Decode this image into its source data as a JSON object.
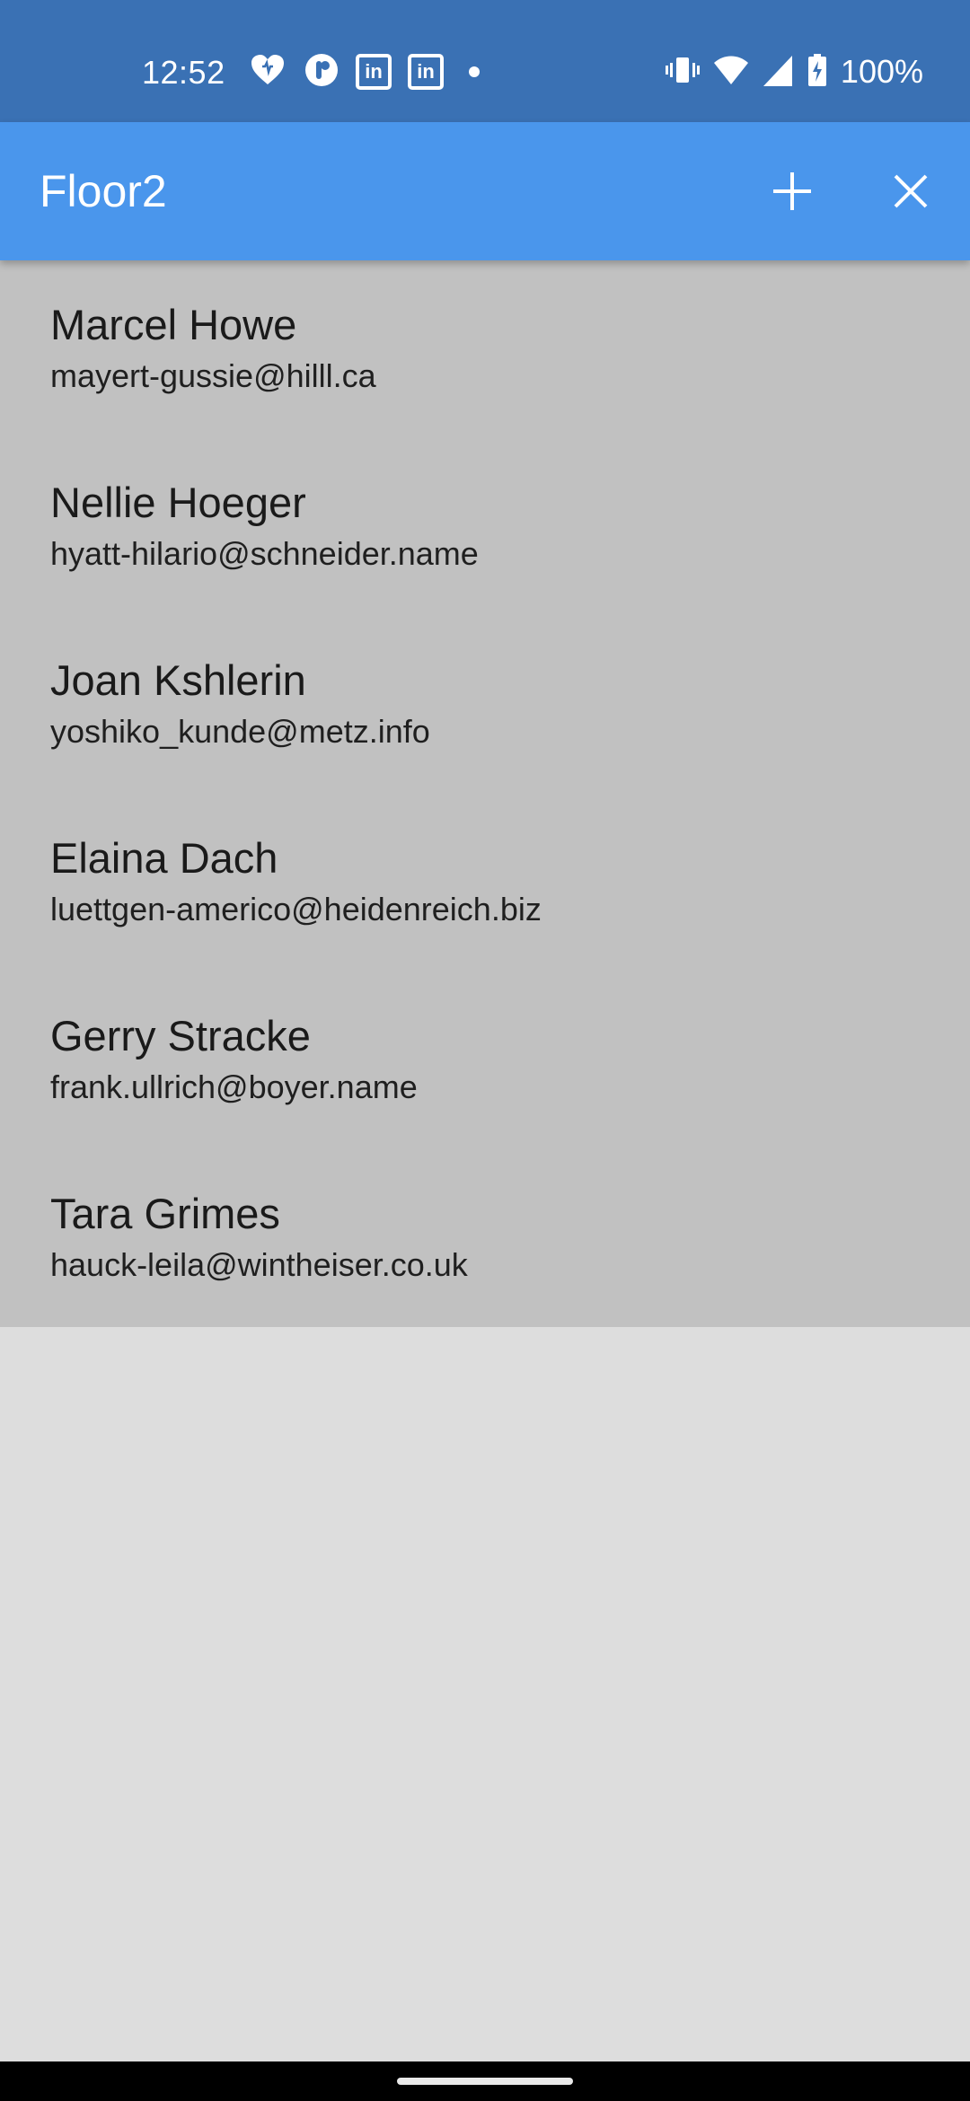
{
  "status_bar": {
    "time": "12:52",
    "battery": "100%",
    "left_icons": [
      "iheartradio-icon",
      "podcast-app-icon",
      "linkedin-icon",
      "linkedin-icon",
      "notification-dot-icon"
    ],
    "right_icons": [
      "vibrate-icon",
      "wifi-icon",
      "cell-signal-icon",
      "battery-charging-icon"
    ]
  },
  "app_bar": {
    "title": "Floor2",
    "actions": [
      "add-icon",
      "close-icon"
    ]
  },
  "people": [
    {
      "name": "Marcel Howe",
      "email": "mayert-gussie@hilll.ca"
    },
    {
      "name": "Nellie Hoeger",
      "email": "hyatt-hilario@schneider.name"
    },
    {
      "name": "Joan Kshlerin",
      "email": "yoshiko_kunde@metz.info"
    },
    {
      "name": "Elaina Dach",
      "email": "luettgen-americo@heidenreich.biz"
    },
    {
      "name": "Gerry Stracke",
      "email": "frank.ullrich@boyer.name"
    },
    {
      "name": "Tara Grimes",
      "email": "hauck-leila@wintheiser.co.uk"
    }
  ],
  "colors": {
    "status_bar": "#3a71b4",
    "app_bar": "#4a96ec",
    "list_background": "#c1c1c1",
    "page_background": "#dddddd"
  }
}
